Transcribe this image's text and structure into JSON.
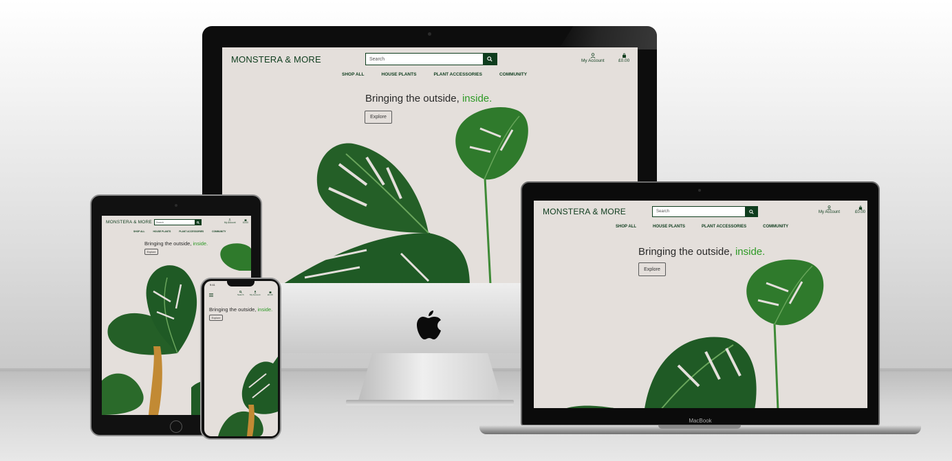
{
  "site": {
    "brand": "MONSTERA & MORE",
    "search_placeholder": "Search",
    "search_label": "Search",
    "account_label": "My Account",
    "basket_total": "£0.00",
    "nav": [
      "SHOP ALL",
      "HOUSE PLANTS",
      "PLANT ACCESSORIES",
      "COMMUNITY"
    ],
    "hero": {
      "title_plain": "Bringing the outside,",
      "title_accent": "inside.",
      "cta": "Explore"
    }
  },
  "devices": {
    "laptop_label": "MacBook",
    "phone_time": "9:41"
  },
  "colors": {
    "brand_green": "#0f3d1e",
    "accent_green": "#2e9a26",
    "screen_bg": "#e4dfdb",
    "leaf_dark": "#1f5a25",
    "leaf_light": "#3e8a36"
  },
  "icons": {
    "search": "search-icon",
    "account": "user-icon",
    "basket": "shopping-bag-icon",
    "menu": "menu-icon",
    "brand_logo": "apple-logo"
  }
}
